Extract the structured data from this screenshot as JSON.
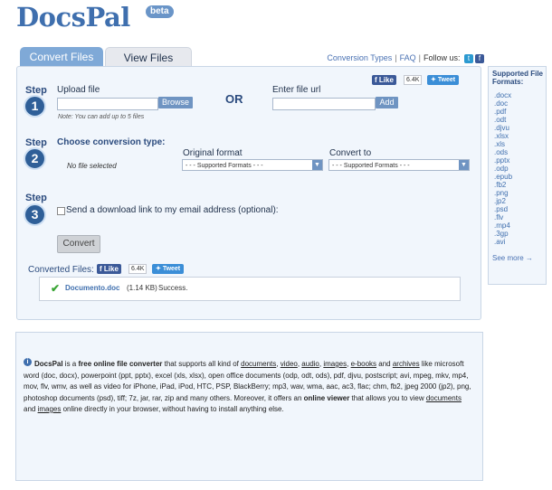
{
  "brand": {
    "name": "DocsPal",
    "badge": "beta"
  },
  "tabs": [
    {
      "label": "Convert Files"
    },
    {
      "label": "View Files"
    }
  ],
  "toplinks": {
    "conversion_types": "Conversion Types",
    "sep": "|",
    "faq": "FAQ",
    "follow": "Follow us:"
  },
  "social": {
    "like": "Like",
    "count": "6.4K",
    "tweet": "Tweet"
  },
  "step1": {
    "step": "Step",
    "num": "1",
    "upload_label": "Upload file",
    "browse": "Browse",
    "note": "Note: You can add up to 5 files",
    "or": "OR",
    "url_label": "Enter file url",
    "add": "Add"
  },
  "step2": {
    "step": "Step",
    "num": "2",
    "title": "Choose conversion type:",
    "no_file": "No file selected",
    "orig_label": "Original format",
    "orig_value": "- - - Supported Formats - - -",
    "conv_label": "Convert to",
    "conv_value": "- - - Supported Formats - - -"
  },
  "step3": {
    "step": "Step",
    "num": "3",
    "email_label": "Send a download link to my email address (optional):"
  },
  "convert_button": "Convert",
  "converted": {
    "label": "Converted Files:",
    "file": "Documento.doc",
    "size": "(1.14 KB)",
    "status": "Success."
  },
  "sidebar": {
    "title": "Supported File Formats:",
    "formats": [
      ".docx",
      ".doc",
      ".pdf",
      ".odt",
      ".djvu",
      ".xlsx",
      ".xls",
      ".ods",
      ".pptx",
      ".odp",
      ".epub",
      ".fb2",
      ".png",
      ".jp2",
      ".psd",
      ".flv",
      ".mp4",
      ".3gp",
      ".avi"
    ],
    "see_more": "See more →"
  },
  "info": {
    "s1": "DocsPal",
    "s2": " is a ",
    "s3": "free online file converter",
    "s4": " that supports all kind of ",
    "l_documents": "documents",
    "c1": ", ",
    "l_video": "video",
    "c2": ", ",
    "l_audio": "audio",
    "c3": ", ",
    "l_images": "images",
    "c4": ", ",
    "l_ebooks": "e-books",
    "s5": " and ",
    "l_archives": "archives",
    "s6": " like microsoft word (doc, docx), powerpoint (ppt, pptx), excel (xls, xlsx), open office documents (odp, odt, ods), pdf, djvu, postscript; avi, mpeg, mkv, mp4, mov, flv, wmv, as well as video for iPhone, iPad, iPod, HTC, PSP, BlackBerry; mp3, wav, wma, aac, ac3, flac; chm, fb2, jpeg 2000 (jp2), png, photoshop documents (psd), tiff; 7z, jar, rar, zip and many others. Moreover, it offers an ",
    "s7": "online viewer",
    "s8": " that allows you to view ",
    "l_documents2": "documents",
    "s9": " and ",
    "l_images2": "images",
    "s10": " online directly in your browser, without having to install anything else."
  }
}
